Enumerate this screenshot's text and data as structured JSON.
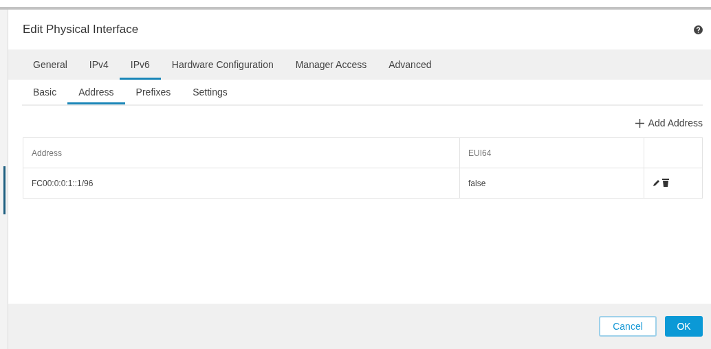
{
  "dialog": {
    "title": "Edit Physical Interface"
  },
  "tabs": [
    {
      "label": "General",
      "selected": false
    },
    {
      "label": "IPv4",
      "selected": false
    },
    {
      "label": "IPv6",
      "selected": true
    },
    {
      "label": "Hardware Configuration",
      "selected": false
    },
    {
      "label": "Manager Access",
      "selected": false
    },
    {
      "label": "Advanced",
      "selected": false
    }
  ],
  "subtabs": [
    {
      "label": "Basic",
      "selected": false
    },
    {
      "label": "Address",
      "selected": true
    },
    {
      "label": "Prefixes",
      "selected": false
    },
    {
      "label": "Settings",
      "selected": false
    }
  ],
  "add_button": "Add Address",
  "table": {
    "columns": [
      "Address",
      "EUI64"
    ],
    "rows": [
      {
        "cells": [
          "FC00:0:0:1::1/96",
          "false"
        ]
      }
    ]
  },
  "buttons": {
    "cancel": "Cancel",
    "ok": "OK"
  }
}
